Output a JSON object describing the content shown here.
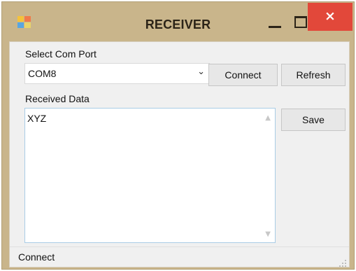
{
  "window": {
    "title": "RECEIVER"
  },
  "titlebar": {
    "close_glyph": "×"
  },
  "com_port": {
    "label": "Select Com Port",
    "selected": "COM8"
  },
  "buttons": {
    "connect": "Connect",
    "refresh": "Refresh",
    "save": "Save"
  },
  "received": {
    "label": "Received Data",
    "value": "XYZ"
  },
  "status_bar": {
    "text": "Connect"
  },
  "colors": {
    "title_bar": "#c9b58b",
    "close_button": "#e2483a",
    "client": "#f0f0f0"
  },
  "icons": {
    "app": "app-icon",
    "minimize": "minimize-icon",
    "maximize": "maximize-icon",
    "close": "close-icon",
    "combo": "chevron-down-icon",
    "grip": "resize-grip-icon"
  }
}
